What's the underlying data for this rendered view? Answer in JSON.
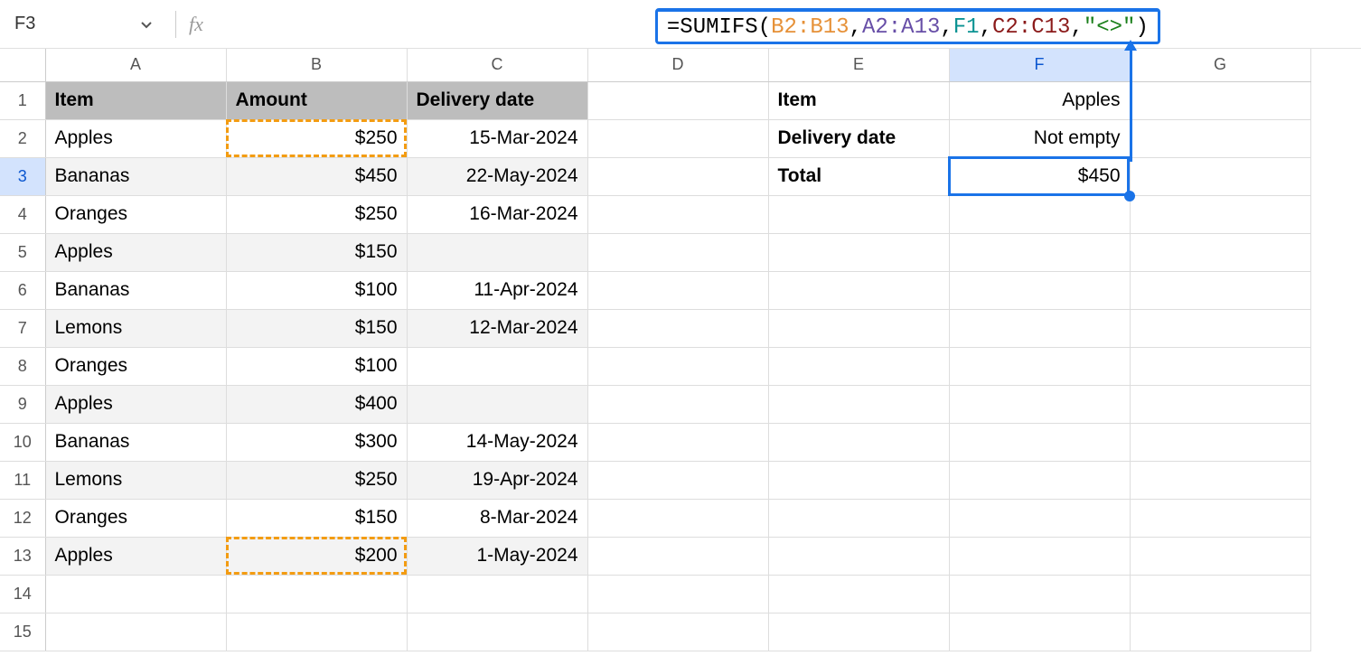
{
  "namebox": {
    "cell_ref": "F3"
  },
  "formula": {
    "raw": "=SUMIFS(B2:B13,A2:A13,F1,C2:C13,\"<>\")",
    "parts": {
      "fn": "SUMIFS",
      "arg1": "B2:B13",
      "arg2": "A2:A13",
      "arg3": "F1",
      "arg4": "C2:C13",
      "arg5": "\"<>\""
    }
  },
  "columns": [
    "A",
    "B",
    "C",
    "D",
    "E",
    "F",
    "G"
  ],
  "row_numbers": [
    "1",
    "2",
    "3",
    "4",
    "5",
    "6",
    "7",
    "8",
    "9",
    "10",
    "11",
    "12",
    "13",
    "14",
    "15"
  ],
  "header_row": {
    "A": "Item",
    "B": "Amount",
    "C": "Delivery date"
  },
  "data_rows": [
    {
      "A": "Apples",
      "B": "$250",
      "C": "15-Mar-2024"
    },
    {
      "A": "Bananas",
      "B": "$450",
      "C": "22-May-2024"
    },
    {
      "A": "Oranges",
      "B": "$250",
      "C": "16-Mar-2024"
    },
    {
      "A": "Apples",
      "B": "$150",
      "C": ""
    },
    {
      "A": "Bananas",
      "B": "$100",
      "C": "11-Apr-2024"
    },
    {
      "A": "Lemons",
      "B": "$150",
      "C": "12-Mar-2024"
    },
    {
      "A": "Oranges",
      "B": "$100",
      "C": ""
    },
    {
      "A": "Apples",
      "B": "$400",
      "C": ""
    },
    {
      "A": "Bananas",
      "B": "$300",
      "C": "14-May-2024"
    },
    {
      "A": "Lemons",
      "B": "$250",
      "C": "19-Apr-2024"
    },
    {
      "A": "Oranges",
      "B": "$150",
      "C": "8-Mar-2024"
    },
    {
      "A": "Apples",
      "B": "$200",
      "C": "1-May-2024"
    }
  ],
  "side_panel": {
    "labels": {
      "item": "Item",
      "delivery": "Delivery date",
      "total": "Total"
    },
    "values": {
      "item": "Apples",
      "delivery": "Not empty",
      "total": "$450"
    }
  }
}
